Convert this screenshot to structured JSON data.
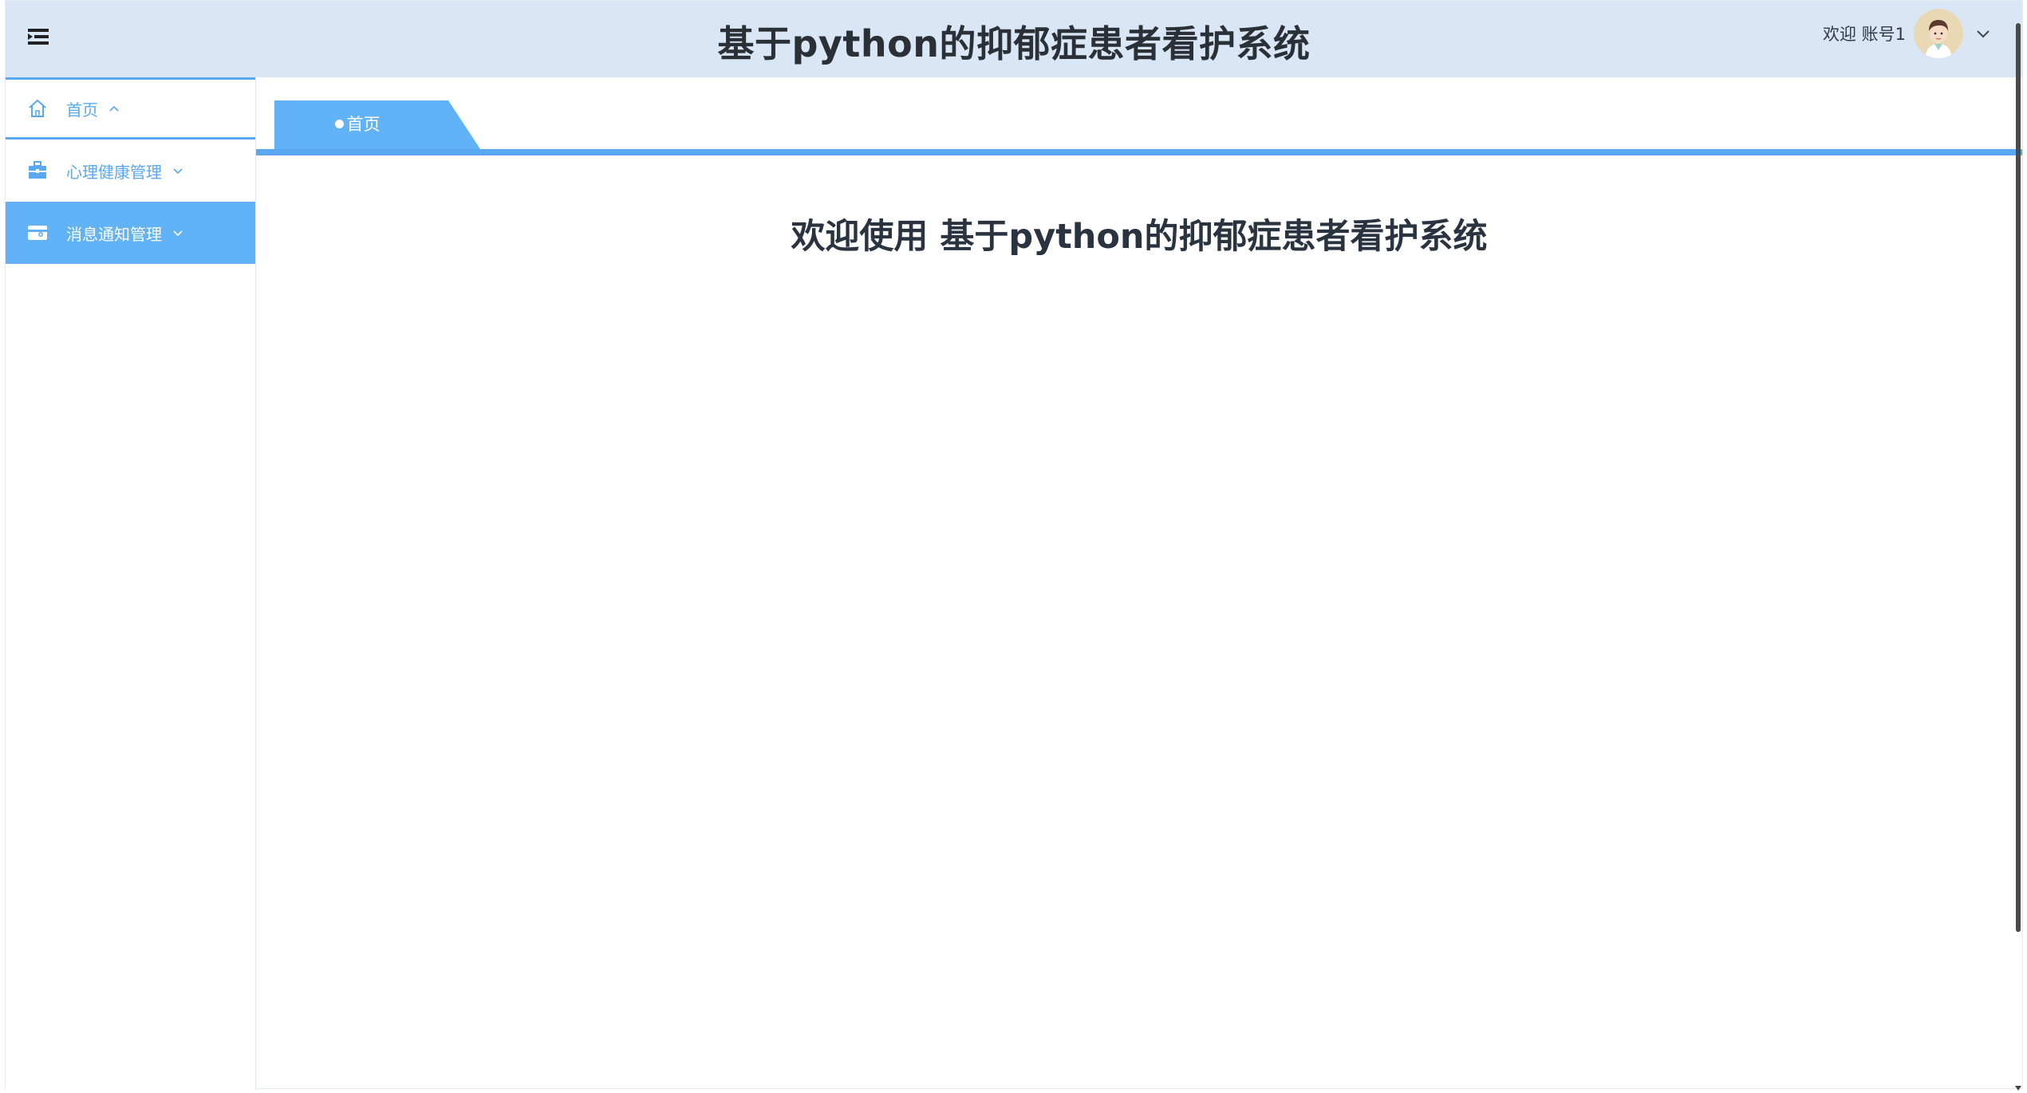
{
  "header": {
    "title": "基于python的抑郁症患者看护系统",
    "welcome": "欢迎 账号1",
    "menu_toggle_icon": "hamburger-icon",
    "avatar_icon": "avatar-icon",
    "user_menu_icon": "chevron-down-icon"
  },
  "sidebar": {
    "items": [
      {
        "label": "首页",
        "icon": "home-icon",
        "chevron": "chevron-up-icon",
        "state": "current"
      },
      {
        "label": "心理健康管理",
        "icon": "briefcase-icon",
        "chevron": "chevron-down-icon",
        "state": "normal"
      },
      {
        "label": "消息通知管理",
        "icon": "message-card-icon",
        "chevron": "chevron-down-icon",
        "state": "active"
      }
    ]
  },
  "tabs": [
    {
      "label": "首页",
      "active": true
    }
  ],
  "main": {
    "welcome_heading": "欢迎使用 基于python的抑郁症患者看护系统"
  },
  "colors": {
    "header_bg": "#d9e6f6",
    "accent": "#5aa8f2",
    "active_menu_bg": "#62b2f7",
    "title_text": "#2b2f36"
  }
}
